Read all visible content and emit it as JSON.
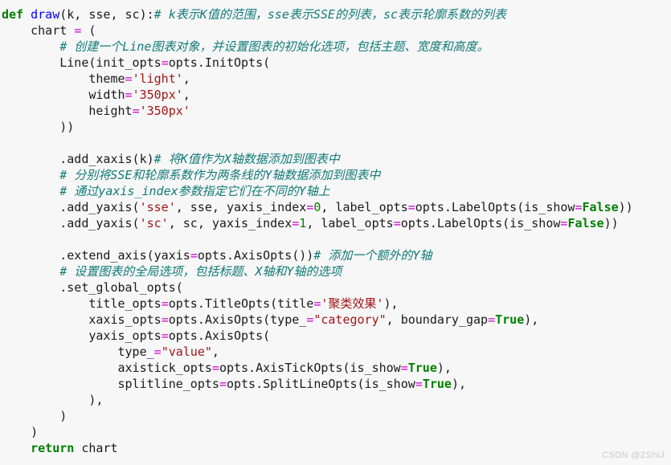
{
  "editor": {
    "background_color": "#f7f7f7",
    "language": "python",
    "watermark": "CSDN @ZShiJ",
    "colors": {
      "keyword": "#008000",
      "function": "#0000ff",
      "string": "#a31515",
      "operator": "#cc00cc",
      "number": "#008000",
      "comment": "#117a78",
      "text": "#1a1a1a"
    }
  },
  "code": {
    "lines": [
      {
        "id": "line-1",
        "tokens": [
          {
            "t": "def",
            "c": "kw"
          },
          {
            "t": " ",
            "c": "plain"
          },
          {
            "t": "draw",
            "c": "fn"
          },
          {
            "t": "(k, sse, sc):",
            "c": "plain"
          },
          {
            "t": "# k表示K值的范围，sse表示SSE的列表，sc表示轮廓系数的列表",
            "c": "cmt"
          }
        ]
      },
      {
        "id": "line-2",
        "tokens": [
          {
            "t": "    chart ",
            "c": "plain"
          },
          {
            "t": "=",
            "c": "op"
          },
          {
            "t": " (",
            "c": "plain"
          }
        ]
      },
      {
        "id": "line-3",
        "tokens": [
          {
            "t": "        ",
            "c": "plain"
          },
          {
            "t": "# 创建一个Line图表对象，并设置图表的初始化选项，包括主题、宽度和高度。",
            "c": "cmt"
          }
        ]
      },
      {
        "id": "line-4",
        "tokens": [
          {
            "t": "        Line(init_opts",
            "c": "plain"
          },
          {
            "t": "=",
            "c": "op"
          },
          {
            "t": "opts.InitOpts(",
            "c": "plain"
          }
        ]
      },
      {
        "id": "line-5",
        "tokens": [
          {
            "t": "            theme",
            "c": "plain"
          },
          {
            "t": "=",
            "c": "op"
          },
          {
            "t": "'light'",
            "c": "str"
          },
          {
            "t": ",",
            "c": "plain"
          }
        ]
      },
      {
        "id": "line-6",
        "tokens": [
          {
            "t": "            width",
            "c": "plain"
          },
          {
            "t": "=",
            "c": "op"
          },
          {
            "t": "'350px'",
            "c": "str"
          },
          {
            "t": ",",
            "c": "plain"
          }
        ]
      },
      {
        "id": "line-7",
        "tokens": [
          {
            "t": "            height",
            "c": "plain"
          },
          {
            "t": "=",
            "c": "op"
          },
          {
            "t": "'350px'",
            "c": "str"
          }
        ]
      },
      {
        "id": "line-8",
        "tokens": [
          {
            "t": "        ))",
            "c": "plain"
          }
        ]
      },
      {
        "id": "line-9",
        "tokens": [
          {
            "t": "",
            "c": "plain"
          }
        ]
      },
      {
        "id": "line-10",
        "tokens": [
          {
            "t": "        .add_xaxis(k)",
            "c": "plain"
          },
          {
            "t": "# 将K值作为X轴数据添加到图表中",
            "c": "cmt"
          }
        ]
      },
      {
        "id": "line-11",
        "tokens": [
          {
            "t": "        ",
            "c": "plain"
          },
          {
            "t": "# 分别将SSE和轮廓系数作为两条线的Y轴数据添加到图表中",
            "c": "cmt"
          }
        ]
      },
      {
        "id": "line-12",
        "tokens": [
          {
            "t": "        ",
            "c": "plain"
          },
          {
            "t": "# 通过yaxis_index参数指定它们在不同的Y轴上",
            "c": "cmt"
          }
        ]
      },
      {
        "id": "line-13",
        "tokens": [
          {
            "t": "        .add_yaxis(",
            "c": "plain"
          },
          {
            "t": "'sse'",
            "c": "str"
          },
          {
            "t": ", sse, yaxis_index",
            "c": "plain"
          },
          {
            "t": "=",
            "c": "op"
          },
          {
            "t": "0",
            "c": "num"
          },
          {
            "t": ", label_opts",
            "c": "plain"
          },
          {
            "t": "=",
            "c": "op"
          },
          {
            "t": "opts.LabelOpts(is_show",
            "c": "plain"
          },
          {
            "t": "=",
            "c": "op"
          },
          {
            "t": "False",
            "c": "kw"
          },
          {
            "t": "))",
            "c": "plain"
          }
        ]
      },
      {
        "id": "line-14",
        "tokens": [
          {
            "t": "        .add_yaxis(",
            "c": "plain"
          },
          {
            "t": "'sc'",
            "c": "str"
          },
          {
            "t": ", sc, yaxis_index",
            "c": "plain"
          },
          {
            "t": "=",
            "c": "op"
          },
          {
            "t": "1",
            "c": "num"
          },
          {
            "t": ", label_opts",
            "c": "plain"
          },
          {
            "t": "=",
            "c": "op"
          },
          {
            "t": "opts.LabelOpts(is_show",
            "c": "plain"
          },
          {
            "t": "=",
            "c": "op"
          },
          {
            "t": "False",
            "c": "kw"
          },
          {
            "t": "))",
            "c": "plain"
          }
        ]
      },
      {
        "id": "line-15",
        "tokens": [
          {
            "t": "",
            "c": "plain"
          }
        ]
      },
      {
        "id": "line-16",
        "tokens": [
          {
            "t": "        .extend_axis(yaxis",
            "c": "plain"
          },
          {
            "t": "=",
            "c": "op"
          },
          {
            "t": "opts.AxisOpts())",
            "c": "plain"
          },
          {
            "t": "# 添加一个额外的Y轴",
            "c": "cmt"
          }
        ]
      },
      {
        "id": "line-17",
        "tokens": [
          {
            "t": "        ",
            "c": "plain"
          },
          {
            "t": "# 设置图表的全局选项，包括标题、X轴和Y轴的选项",
            "c": "cmt"
          }
        ]
      },
      {
        "id": "line-18",
        "tokens": [
          {
            "t": "        .set_global_opts(",
            "c": "plain"
          }
        ]
      },
      {
        "id": "line-19",
        "tokens": [
          {
            "t": "            title_opts",
            "c": "plain"
          },
          {
            "t": "=",
            "c": "op"
          },
          {
            "t": "opts.TitleOpts(title",
            "c": "plain"
          },
          {
            "t": "=",
            "c": "op"
          },
          {
            "t": "'聚类效果'",
            "c": "str"
          },
          {
            "t": "),",
            "c": "plain"
          }
        ]
      },
      {
        "id": "line-20",
        "tokens": [
          {
            "t": "            xaxis_opts",
            "c": "plain"
          },
          {
            "t": "=",
            "c": "op"
          },
          {
            "t": "opts.AxisOpts(type_",
            "c": "plain"
          },
          {
            "t": "=",
            "c": "op"
          },
          {
            "t": "\"category\"",
            "c": "str"
          },
          {
            "t": ", boundary_gap",
            "c": "plain"
          },
          {
            "t": "=",
            "c": "op"
          },
          {
            "t": "True",
            "c": "kw"
          },
          {
            "t": "),",
            "c": "plain"
          }
        ]
      },
      {
        "id": "line-21",
        "tokens": [
          {
            "t": "            yaxis_opts",
            "c": "plain"
          },
          {
            "t": "=",
            "c": "op"
          },
          {
            "t": "opts.AxisOpts(",
            "c": "plain"
          }
        ]
      },
      {
        "id": "line-22",
        "tokens": [
          {
            "t": "                type_",
            "c": "plain"
          },
          {
            "t": "=",
            "c": "op"
          },
          {
            "t": "\"value\"",
            "c": "str"
          },
          {
            "t": ",",
            "c": "plain"
          }
        ]
      },
      {
        "id": "line-23",
        "tokens": [
          {
            "t": "                axistick_opts",
            "c": "plain"
          },
          {
            "t": "=",
            "c": "op"
          },
          {
            "t": "opts.AxisTickOpts(is_show",
            "c": "plain"
          },
          {
            "t": "=",
            "c": "op"
          },
          {
            "t": "True",
            "c": "kw"
          },
          {
            "t": "),",
            "c": "plain"
          }
        ]
      },
      {
        "id": "line-24",
        "tokens": [
          {
            "t": "                splitline_opts",
            "c": "plain"
          },
          {
            "t": "=",
            "c": "op"
          },
          {
            "t": "opts.SplitLineOpts(is_show",
            "c": "plain"
          },
          {
            "t": "=",
            "c": "op"
          },
          {
            "t": "True",
            "c": "kw"
          },
          {
            "t": "),",
            "c": "plain"
          }
        ]
      },
      {
        "id": "line-25",
        "tokens": [
          {
            "t": "            ),",
            "c": "plain"
          }
        ]
      },
      {
        "id": "line-26",
        "tokens": [
          {
            "t": "        )",
            "c": "plain"
          }
        ]
      },
      {
        "id": "line-27",
        "tokens": [
          {
            "t": "    )",
            "c": "plain"
          }
        ]
      },
      {
        "id": "line-28",
        "tokens": [
          {
            "t": "    ",
            "c": "plain"
          },
          {
            "t": "return",
            "c": "kw"
          },
          {
            "t": " chart",
            "c": "plain"
          }
        ]
      }
    ]
  }
}
